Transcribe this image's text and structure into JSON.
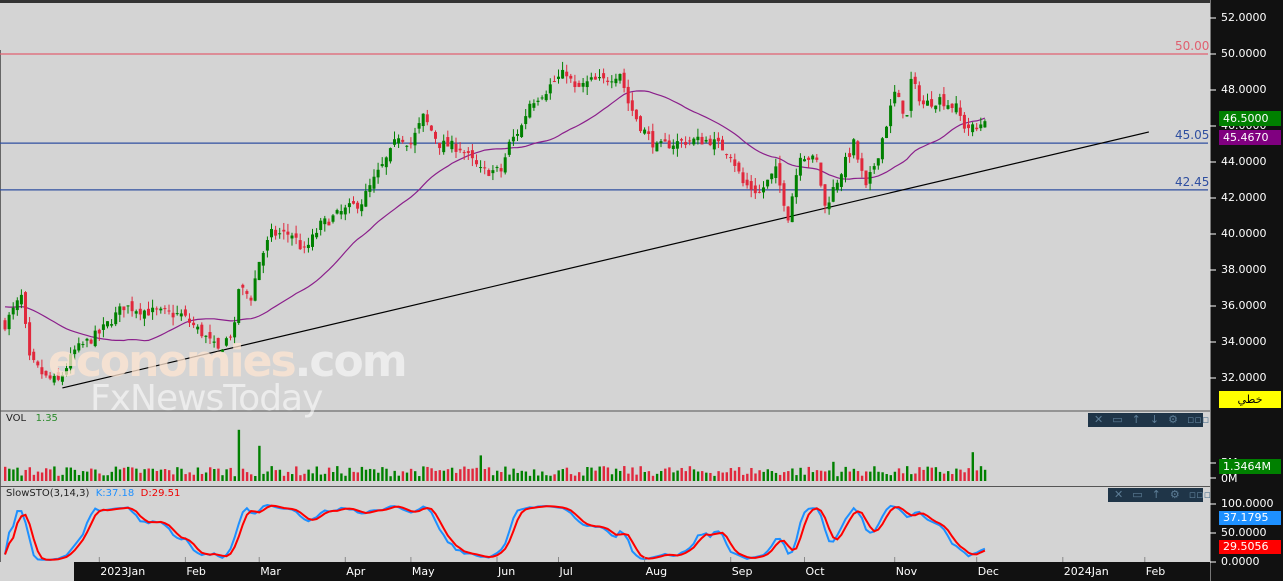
{
  "chart_data": {
    "type": "candlestick",
    "instrument_note": "",
    "price_axis": {
      "ticks": [
        "52.0000",
        "50.0000",
        "48.0000",
        "46.0000",
        "44.0000",
        "42.0000",
        "40.0000",
        "38.0000",
        "36.0000",
        "34.0000",
        "32.0000"
      ],
      "tick_values": [
        52,
        50,
        48,
        46,
        44,
        42,
        40,
        38,
        36,
        34,
        32
      ]
    },
    "time_axis": {
      "labels": [
        "2023Jan",
        "Feb",
        "Mar",
        "Apr",
        "May",
        "Jun",
        "Jul",
        "Aug",
        "Sep",
        "Oct",
        "Nov",
        "Dec",
        "2024Jan",
        "Feb"
      ],
      "day_index": [
        23,
        44,
        62,
        83,
        99,
        120,
        135,
        156,
        177,
        195,
        217,
        237,
        258,
        278
      ]
    },
    "days": 240,
    "close_path": [
      [
        0,
        35
      ],
      [
        4,
        36.5
      ],
      [
        6,
        33
      ],
      [
        10,
        32
      ],
      [
        13,
        31.8
      ],
      [
        17,
        33.5
      ],
      [
        23,
        34.5
      ],
      [
        29,
        36
      ],
      [
        35,
        35.7
      ],
      [
        43,
        35.5
      ],
      [
        48,
        34.5
      ],
      [
        52,
        33.5
      ],
      [
        56,
        34.8
      ],
      [
        57,
        37
      ],
      [
        60,
        36.5
      ],
      [
        62,
        38.5
      ],
      [
        65,
        40
      ],
      [
        70,
        40
      ],
      [
        73,
        39
      ],
      [
        77,
        40.5
      ],
      [
        82,
        41.2
      ],
      [
        87,
        41.8
      ],
      [
        90,
        43
      ],
      [
        94,
        44.5
      ],
      [
        96,
        45.5
      ],
      [
        99,
        45
      ],
      [
        102,
        46.5
      ],
      [
        106,
        45
      ],
      [
        111,
        44.8
      ],
      [
        116,
        43.5
      ],
      [
        121,
        43.5
      ],
      [
        123,
        45
      ],
      [
        126,
        46
      ],
      [
        128,
        47.3
      ],
      [
        132,
        48
      ],
      [
        134,
        48.5
      ],
      [
        137,
        49
      ],
      [
        139,
        48
      ],
      [
        143,
        48.5
      ],
      [
        146,
        48.5
      ],
      [
        150,
        49
      ],
      [
        152,
        47.3
      ],
      [
        155,
        46
      ],
      [
        159,
        44.8
      ],
      [
        162,
        45
      ],
      [
        167,
        45.2
      ],
      [
        172,
        45.2
      ],
      [
        177,
        44.5
      ],
      [
        180,
        42.8
      ],
      [
        184,
        42.3
      ],
      [
        188,
        43.5
      ],
      [
        191,
        41
      ],
      [
        194,
        44.5
      ],
      [
        198,
        44
      ],
      [
        200,
        41.5
      ],
      [
        204,
        43.5
      ],
      [
        207,
        45
      ],
      [
        210,
        42.5
      ],
      [
        213,
        44.5
      ],
      [
        217,
        47.8
      ],
      [
        220,
        46.5
      ],
      [
        221,
        48.5
      ],
      [
        224,
        47.2
      ],
      [
        228,
        47.5
      ],
      [
        232,
        47
      ],
      [
        234,
        46
      ],
      [
        237,
        45.8
      ],
      [
        239,
        46.5
      ]
    ],
    "horizontal_levels": [
      {
        "value": 50.0,
        "label": "50.00",
        "color": "#e06070"
      },
      {
        "value": 45.05,
        "label": "45.05",
        "color": "#2f4fa0"
      },
      {
        "value": 42.45,
        "label": "42.45",
        "color": "#2f4fa0"
      }
    ],
    "trendline": {
      "start": [
        14,
        31.45
      ],
      "end": [
        279,
        45.67
      ],
      "color": "#000000"
    },
    "moving_average": {
      "color": "#8b1f8b",
      "last_value": "45.4670"
    },
    "last_price": "46.5000",
    "last_price_color": "#008000",
    "ma_tag_color": "#800080",
    "style_tag": "خطي",
    "volume": {
      "title": "VOL",
      "value": "1.35",
      "ticks": [
        "5M",
        "0M"
      ],
      "last": "1.3464M",
      "spikes_m": [
        [
          57,
          16
        ],
        [
          62,
          11
        ],
        [
          116,
          8
        ],
        [
          202,
          6
        ],
        [
          236,
          9
        ]
      ]
    },
    "stochastic": {
      "title": "SlowSTO(3,14,3)",
      "k_label": "K:37.18",
      "d_label": "D:29.51",
      "ticks": [
        "100.0000",
        "50.0000",
        "0.0000"
      ],
      "k_last": "37.1795",
      "d_last": "29.5056",
      "k_color": "#1e90ff",
      "d_color": "#ff0000"
    },
    "up_color": "#008000",
    "down_color": "#e0283c"
  },
  "watermark": {
    "line1": "economies",
    "line1_suffix": ".com",
    "line2": "FxNewsToday"
  },
  "panel_tools": [
    "✕",
    "▭",
    "↑",
    "↓",
    "⚙",
    "▫▫▫"
  ]
}
